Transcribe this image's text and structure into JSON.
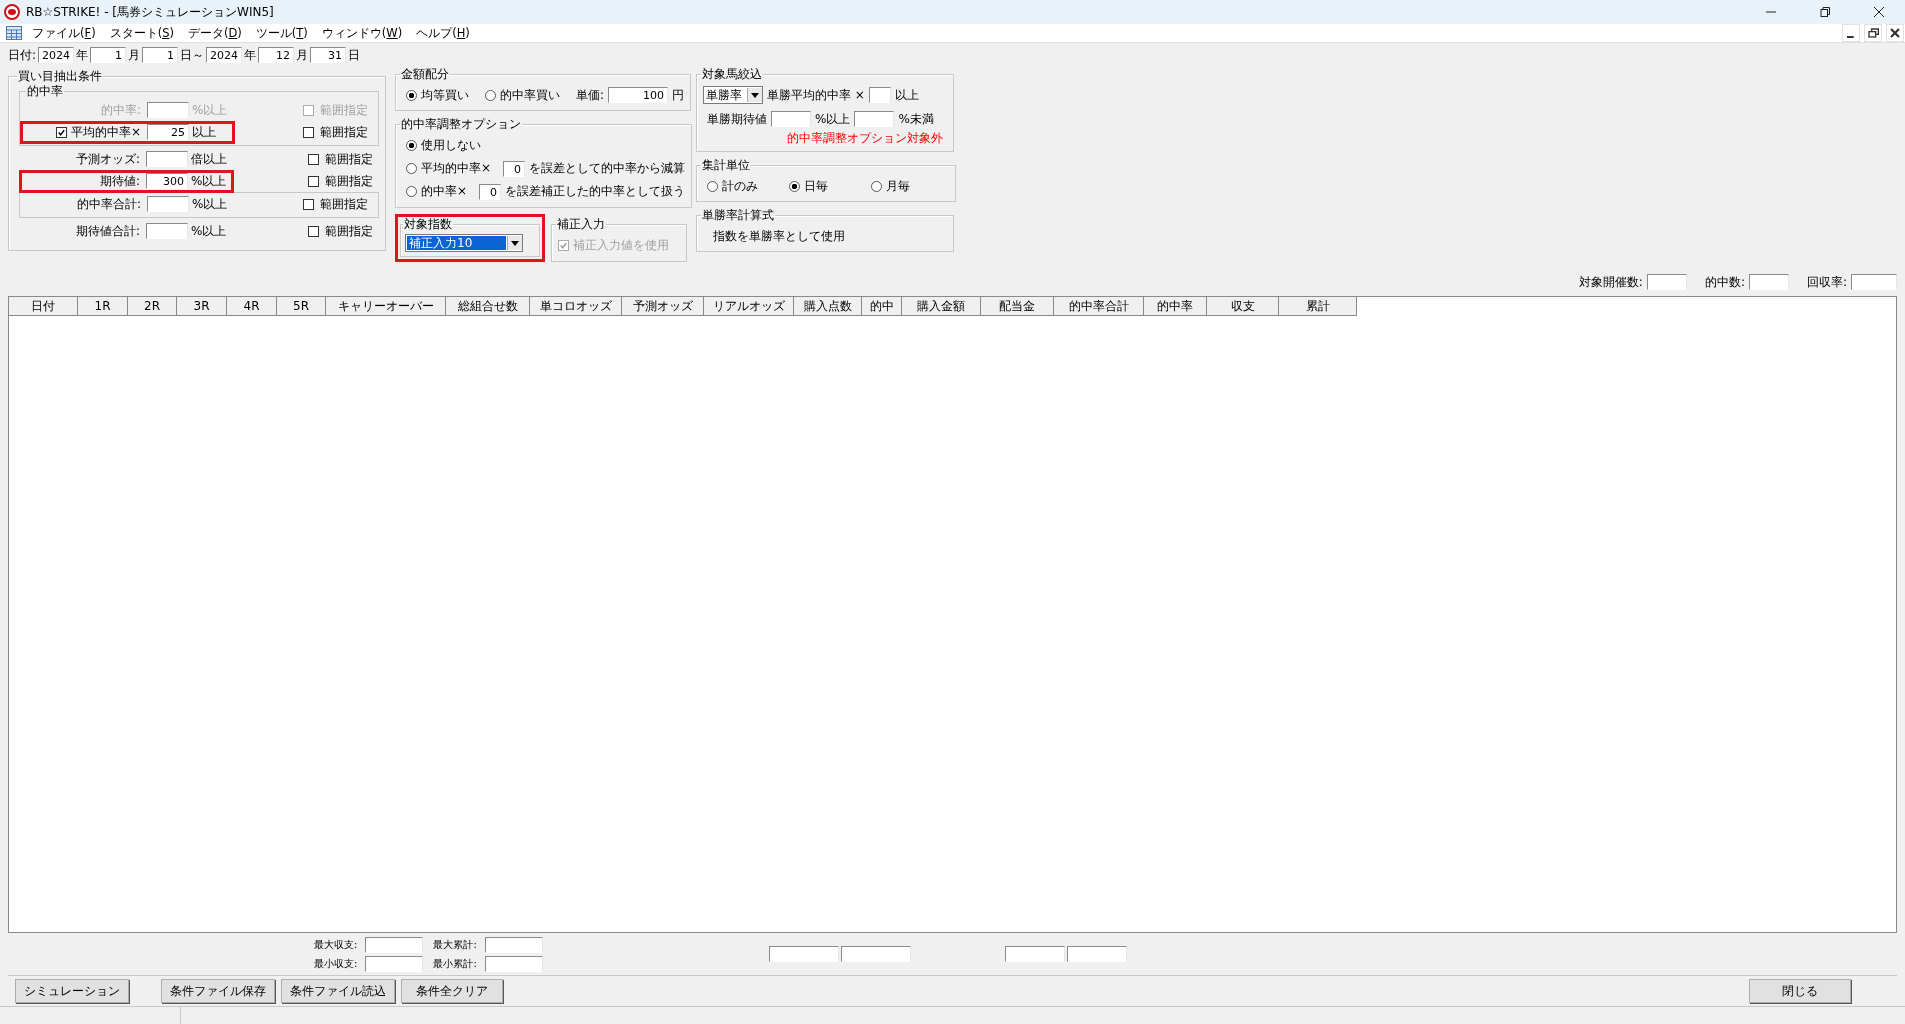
{
  "window": {
    "title": "RB☆STRIKE! - [馬券シミュレーションWIN5]"
  },
  "menu": [
    {
      "before": "ファイル(",
      "key": "F",
      "after": ")"
    },
    {
      "before": "スタート(",
      "key": "S",
      "after": ")"
    },
    {
      "before": "データ(",
      "key": "D",
      "after": ")"
    },
    {
      "before": "ツール(",
      "key": "T",
      "after": ")"
    },
    {
      "before": "ウィンドウ(",
      "key": "W",
      "after": ")"
    },
    {
      "before": "ヘルプ(",
      "key": "H",
      "after": ")"
    }
  ],
  "date_row": [
    {
      "kind": "label",
      "text": "日付:"
    },
    {
      "kind": "field",
      "value": "2024"
    },
    {
      "kind": "label",
      "text": "年"
    },
    {
      "kind": "field",
      "value": "1"
    },
    {
      "kind": "label",
      "text": "月"
    },
    {
      "kind": "field",
      "value": "1"
    },
    {
      "kind": "label",
      "text": "日～"
    },
    {
      "kind": "field",
      "value": "2024"
    },
    {
      "kind": "label",
      "text": "年"
    },
    {
      "kind": "field",
      "value": "12"
    },
    {
      "kind": "label",
      "text": "月"
    },
    {
      "kind": "field",
      "value": "31"
    },
    {
      "kind": "label",
      "text": "日"
    }
  ],
  "extraction": {
    "title": "買い目抽出条件",
    "sections": [
      {
        "title": "的中率",
        "boxed": true,
        "rows": [
          {
            "kind": "plain",
            "label": "的中率:",
            "unit": "%以上",
            "range_label": "範囲指定",
            "range_checked": false,
            "disabled": true,
            "highlighted": false
          },
          {
            "kind": "check",
            "checked": true,
            "label": "平均的中率×",
            "value": "25",
            "unit": "以上",
            "range_label": "範囲指定",
            "range_checked": false,
            "disabled": false,
            "highlighted": true
          }
        ]
      },
      {
        "boxed": false,
        "rows": [
          {
            "kind": "plain",
            "label": "予測オッズ:",
            "unit": "倍以上",
            "range_label": "範囲指定",
            "range_checked": false,
            "disabled": false,
            "highlighted": false
          },
          {
            "kind": "plain",
            "label": "期待値:",
            "value": "300",
            "unit": "%以上",
            "range_label": "範囲指定",
            "range_checked": false,
            "disabled": false,
            "highlighted": true
          }
        ]
      },
      {
        "boxed": true,
        "rows": [
          {
            "kind": "plain",
            "label": "的中率合計:",
            "unit": "%以上",
            "range_label": "範囲指定",
            "range_checked": false,
            "disabled": false,
            "highlighted": false
          }
        ]
      },
      {
        "boxed": false,
        "rows": [
          {
            "kind": "plain",
            "label": "期待値合計:",
            "unit": "%以上",
            "range_label": "範囲指定",
            "range_checked": false,
            "disabled": false,
            "highlighted": false
          }
        ]
      }
    ]
  },
  "allocation": {
    "title": "金額配分",
    "options": [
      {
        "label": "均等買い",
        "selected": true
      },
      {
        "label": "的中率買い",
        "selected": false
      }
    ],
    "price_label": "単価:",
    "price": "100",
    "price_unit": "円"
  },
  "adjustment": {
    "title": "的中率調整オプション",
    "options": [
      {
        "kind": "plain",
        "label": "使用しない",
        "selected": true
      },
      {
        "kind": "field",
        "label": "平均的中率×",
        "value": "0",
        "suffix": "を誤差として的中率から減算",
        "selected": false
      },
      {
        "kind": "field",
        "label": "的中率×",
        "value": "0",
        "suffix": "を誤差補正した的中率として扱う",
        "selected": false
      }
    ]
  },
  "target_index": {
    "title": "対象指数",
    "value": "補正入力10",
    "highlighted": true
  },
  "correction": {
    "title": "補正入力",
    "checkbox_label": "補正入力値を使用",
    "checked": true,
    "disabled": true
  },
  "horse_filter": {
    "title": "対象馬絞込",
    "select": "単勝率",
    "rate_label": "単勝平均的中率 ×",
    "rate_unit": "以上",
    "ev_label": "単勝期待値",
    "ev_min_unit": "%以上",
    "ev_max_unit": "%未満",
    "note": "的中率調整オプション対象外"
  },
  "aggregation": {
    "title": "集計単位",
    "options": [
      {
        "label": "計のみ",
        "selected": false
      },
      {
        "label": "日毎",
        "selected": true
      },
      {
        "label": "月毎",
        "selected": false
      }
    ]
  },
  "formula": {
    "title": "単勝率計算式",
    "text": "指数を単勝率として使用"
  },
  "stats": [
    {
      "label": "対象開催数:"
    },
    {
      "label": "的中数:"
    },
    {
      "label": "回収率:"
    }
  ],
  "table": {
    "columns": [
      "日付",
      "1R",
      "2R",
      "3R",
      "4R",
      "5R",
      "キャリーオーバー",
      "総組合せ数",
      "単コロオッズ",
      "予測オッズ",
      "リアルオッズ",
      "購入点数",
      "的中",
      "購入金額",
      "配当金",
      "的中率合計",
      "的中率",
      "収支",
      "累計"
    ]
  },
  "summary": [
    {
      "label": "最大収支:"
    },
    {
      "label": "最大累計:"
    },
    {
      "label": "最小収支:"
    },
    {
      "label": "最小累計:"
    }
  ],
  "buttons": [
    {
      "label": "シミュレーション"
    },
    {
      "label": "条件ファイル保存"
    },
    {
      "label": "条件ファイル読込"
    },
    {
      "label": "条件全クリア"
    }
  ],
  "close_button": {
    "label": "閉じる"
  }
}
